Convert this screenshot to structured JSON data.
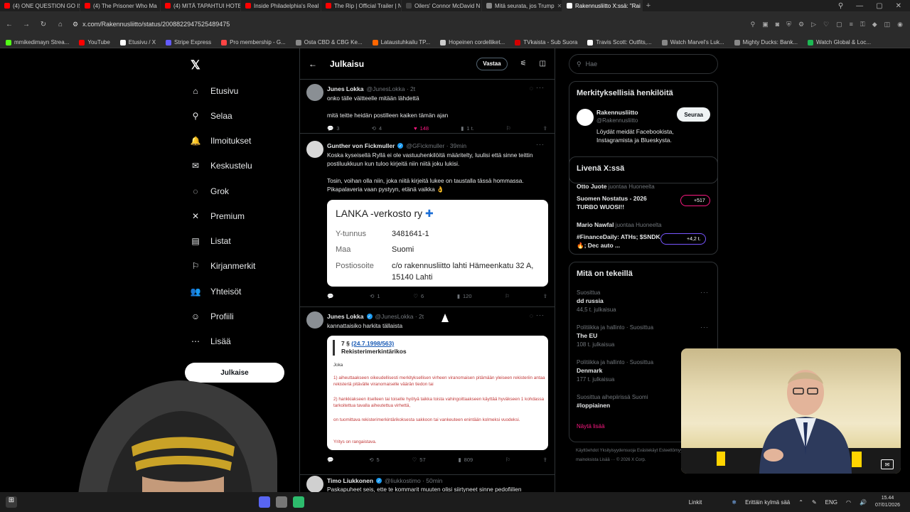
{
  "browser": {
    "tabs": [
      {
        "title": "(4) ONE QUESTION GO IS",
        "color": "#ff0000"
      },
      {
        "title": "(4) The Prisoner Who Ma",
        "color": "#ff0000"
      },
      {
        "title": "(4) MITÄ TAPAHTUI HOTE",
        "color": "#ff0000"
      },
      {
        "title": "Inside Philadelphia's Real",
        "color": "#ff0000"
      },
      {
        "title": "The Rip | Official Trailer | N",
        "color": "#ff0000"
      },
      {
        "title": "Oilers' Connor McDavid N",
        "color": "#444444"
      },
      {
        "title": "Mitä seurata, jos Trump",
        "color": "#888888"
      },
      {
        "title": "Rakennusliitto X:ssä: \"Rai",
        "color": "#ffffff",
        "active": true
      }
    ],
    "url": "x.com/Rakennusliitto/status/2008822947525489475",
    "bookmarks": [
      {
        "label": "mmikedimayn Strea...",
        "color": "#53fc18"
      },
      {
        "label": "YouTube",
        "color": "#ff0000"
      },
      {
        "label": "Etusivu / X",
        "color": "#ffffff"
      },
      {
        "label": "Stripe Express",
        "color": "#635bff"
      },
      {
        "label": "Pro membership - G...",
        "color": "#ff4444"
      },
      {
        "label": "Osta CBD & CBG Ke...",
        "color": "#888888"
      },
      {
        "label": "Lataustuhkailu TP...",
        "color": "#ff6600"
      },
      {
        "label": "Hopeinen cordelliket...",
        "color": "#cccccc"
      },
      {
        "label": "TVkaista - Sub Suora",
        "color": "#d40000"
      },
      {
        "label": "Travis Scott: Outfits,...",
        "color": "#ffffff"
      },
      {
        "label": "Watch Marvel's Luk...",
        "color": "#888888"
      },
      {
        "label": "Mighty Ducks: Bank...",
        "color": "#888888"
      },
      {
        "label": "Watch Global & Loc...",
        "color": "#1db954"
      }
    ]
  },
  "nav": {
    "items": [
      {
        "label": "Etusivu",
        "icon": "home-icon",
        "glyph": "⌂"
      },
      {
        "label": "Selaa",
        "icon": "search-icon",
        "glyph": "⚲"
      },
      {
        "label": "Ilmoitukset",
        "icon": "bell-icon",
        "glyph": "🔔"
      },
      {
        "label": "Keskustelu",
        "icon": "mail-icon",
        "glyph": "✉"
      },
      {
        "label": "Grok",
        "icon": "grok-icon",
        "glyph": "◌"
      },
      {
        "label": "Premium",
        "icon": "x-premium-icon",
        "glyph": "✕"
      },
      {
        "label": "Listat",
        "icon": "list-icon",
        "glyph": "▤"
      },
      {
        "label": "Kirjanmerkit",
        "icon": "bookmark-icon",
        "glyph": "⚐"
      },
      {
        "label": "Yhteisöt",
        "icon": "communities-icon",
        "glyph": "👥"
      },
      {
        "label": "Profiili",
        "icon": "profile-icon",
        "glyph": "☺"
      },
      {
        "label": "Lisää",
        "icon": "more-icon",
        "glyph": "⋯"
      }
    ],
    "post_button": "Julkaise"
  },
  "header": {
    "title": "Julkaisu",
    "reply_button": "Vastaa"
  },
  "tweets": [
    {
      "name": "Junes Lokka",
      "handle": "@JunesLokka · 2t",
      "text1": "onko tälle väitteelle mitään lähdettä",
      "text2": "mitä teitte heidän postilleen kaiken tämän ajan",
      "replies": "3",
      "reposts": "4",
      "likes": "148",
      "views": "1 t."
    },
    {
      "name": "Gunther von Fickmuller",
      "handle": "@GFickmuller · 39min",
      "text": "Koska kyseisellä Ryllä ei ole vastuuhenkilöitä määritelty, luulisi että sinne teittin postiluukkuun kun tuloo kirjeitä niin niitä joku lukisi.\n\nTosin, voihan olla niin, joka niitä kirjeitä lukee on taustalla tässä hommassa. Pikapalaveria vaan pystyyn, etänä vaikka 👌",
      "card": {
        "title": "LANKA -verkosto ry",
        "rows": [
          {
            "k": "Y-tunnus",
            "v": "3481641-1"
          },
          {
            "k": "Maa",
            "v": "Suomi"
          },
          {
            "k": "Postiosoite",
            "v": "c/o rakennusliitto lahti Hämeenkatu 32 A, 15140 Lahti"
          }
        ]
      },
      "replies": "",
      "reposts": "1",
      "likes": "6",
      "views": "120"
    },
    {
      "name": "Junes Lokka",
      "handle": "@JunesLokka · 2t",
      "text": "kannattaisiko harkita tällaista",
      "law": {
        "section": "7 §",
        "link": "(24.7.1998/563)",
        "heading": "Rekisterimerkintärikos",
        "p1": "Joka",
        "p2": "1) aiheuttaakseen oikeudellisesti merkityksellisen virheen viranomaisen pitämään yleiseen rekisteriin antaa rekisteriä pitävälle viranomaiselle väärän tiedon tai",
        "p3": "2) hankkiakseen itselleen tai toiselle hyötyä taikka toista vahingoittaakseen käyttää hyväkseen 1 kohdassa tarkoitettua tavalla aiheutettua virhettä,",
        "p4": "on tuomittava rekisterimerkintärikoksesta sakkoon tai vankeuteen enintään kolmeksi vuodeksi.",
        "p5": "Yritys on rangaistava."
      },
      "replies": "",
      "reposts": "5",
      "likes": "57",
      "views": "809"
    },
    {
      "name": "Timo Liukkonen",
      "handle": "@liukkostimo · 50min",
      "text": "Paskapuheet seis, ette te kommarit muuten olisi siirtyneet sinne pedofiilien"
    }
  ],
  "right": {
    "search_placeholder": "Hae",
    "relevant_title": "Merkityksellisiä henkilöitä",
    "relevant_name": "Rakennusliitto",
    "relevant_handle": "@Rakennusliitto",
    "relevant_bio": "Löydät meidät Facebookista, Instagramista ja Blueskysta.",
    "follow_label": "Seuraa",
    "live_title": "Livenä X:ssä",
    "live": [
      {
        "host": "Otto Juote",
        "sub": "juontaa Huoneelta",
        "title": "Suomen Nostatus - 2026 TURBO WUOSI!!",
        "count": "+517"
      },
      {
        "host": "Mario Nawfal",
        "sub": "juontaa Huoneelta",
        "title": "#FinanceDaily: ATHs; $SNDK 🔥; Dec auto ...",
        "count": "+4,2 t."
      }
    ],
    "happening_title": "Mitä on tekeillä",
    "trends": [
      {
        "cat": "Suosittua",
        "topic": "dd russia",
        "count": "44,5 t. julkaisua"
      },
      {
        "cat": "Politiikka ja hallinto · Suosittua",
        "topic": "The EU",
        "count": "108 t. julkaisua"
      },
      {
        "cat": "Politiikka ja hallinto · Suosittua",
        "topic": "Denmark",
        "count": "177 t. julkaisua"
      },
      {
        "cat": "Suosittua aihepiirissä Suomi",
        "topic": "#loppiainen",
        "count": ""
      }
    ],
    "show_more": "Näytä lisää",
    "footer": "Käyttöehdot   Yksityisyydensuoja   Evästekäyt   Esteettömyys   Tietoa mainoksista   Lisää ···   © 2026 X Corp."
  },
  "taskbar": {
    "links": "Linkit",
    "weather": "Erittäin kylmä sää",
    "lang": "ENG",
    "time": "15.44",
    "date": "07/01/2026"
  }
}
